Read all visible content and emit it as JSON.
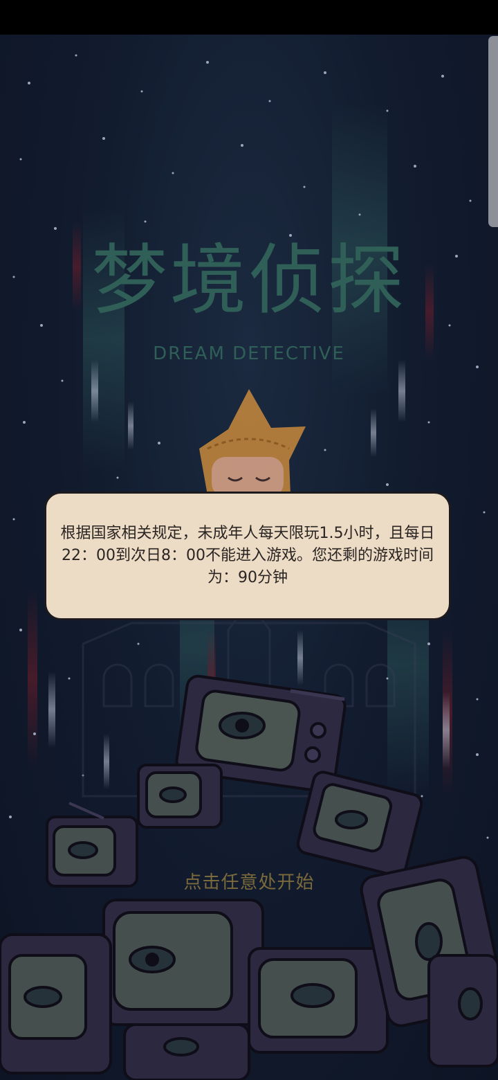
{
  "game": {
    "title_cn": "梦境侦探",
    "title_en": "DREAM DETECTIVE"
  },
  "notice": {
    "message": "根据国家相关规定，未成年人每天限玩1.5小时，且每日22：00到次日8：00不能进入游戏。您还剩的游戏时间为：90分钟"
  },
  "start": {
    "hint": "点击任意处开始"
  },
  "colors": {
    "background": "#111a2c",
    "title": "#2f5f57",
    "dialog_bg": "#ecdcc5",
    "dialog_border": "#1c1a1e",
    "hint": "#7a6a3c",
    "character_hat": "#c98a3c"
  }
}
